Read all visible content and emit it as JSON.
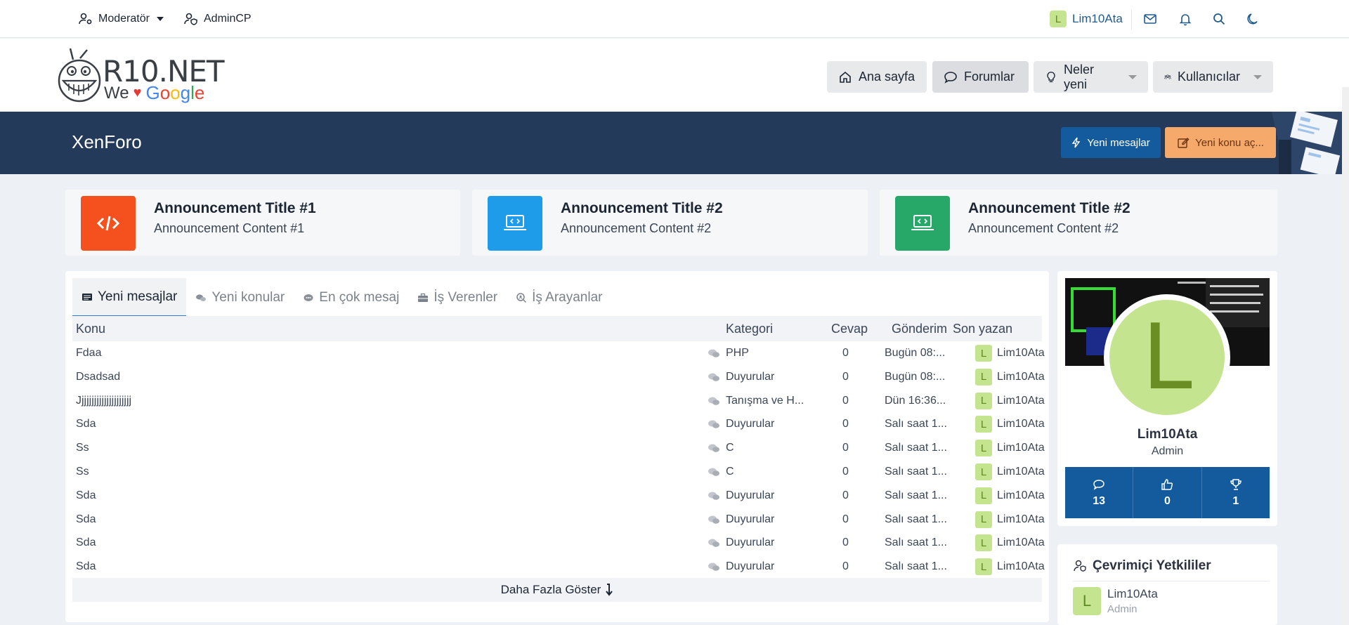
{
  "topbar": {
    "moderator_label": "Moderatör",
    "admincp_label": "AdminCP",
    "user_initial": "L",
    "username": "Lim10Ata"
  },
  "logo": {
    "name": "R10.NET",
    "tagline_we": "We",
    "tagline_google": [
      "G",
      "o",
      "o",
      "g",
      "l",
      "e"
    ]
  },
  "nav": {
    "home": "Ana sayfa",
    "forums": "Forumlar",
    "whats_new": "Neler yeni",
    "users": "Kullanıcılar"
  },
  "banner": {
    "title": "XenForo",
    "new_messages": "Yeni mesajlar",
    "new_topic": "Yeni konu aç..."
  },
  "announcements": [
    {
      "title": "Announcement Title #1",
      "content": "Announcement Content #1",
      "color": "#f4511e",
      "icon": "code-icon"
    },
    {
      "title": "Announcement Title #2",
      "content": "Announcement Content #2",
      "color": "#1e9be9",
      "icon": "laptop-code-icon"
    },
    {
      "title": "Announcement Title #2",
      "content": "Announcement Content #2",
      "color": "#27a869",
      "icon": "laptop-code-icon"
    }
  ],
  "tabs": [
    "Yeni mesajlar",
    "Yeni konular",
    "En çok mesaj",
    "İş Verenler",
    "İş Arayanlar"
  ],
  "table": {
    "headers": {
      "topic": "Konu",
      "category": "Kategori",
      "replies": "Cevap",
      "sent": "Gönderim",
      "last_poster": "Son yazan"
    },
    "rows": [
      {
        "topic": "Fdaa",
        "category": "PHP",
        "replies": "0",
        "sent": "Bugün 08:...",
        "initial": "L",
        "user": "Lim10Ata"
      },
      {
        "topic": "Dsadsad",
        "category": "Duyurular",
        "replies": "0",
        "sent": "Bugün 08:...",
        "initial": "L",
        "user": "Lim10Ata"
      },
      {
        "topic": "Jjjjjjjjjjjjjjjjjjjjj",
        "category": "Tanışma ve H...",
        "replies": "0",
        "sent": "Dün 16:36...",
        "initial": "L",
        "user": "Lim10Ata"
      },
      {
        "topic": "Sda",
        "category": "Duyurular",
        "replies": "0",
        "sent": "Salı saat 1...",
        "initial": "L",
        "user": "Lim10Ata"
      },
      {
        "topic": "Ss",
        "category": "C",
        "replies": "0",
        "sent": "Salı saat 1...",
        "initial": "L",
        "user": "Lim10Ata"
      },
      {
        "topic": "Ss",
        "category": "C",
        "replies": "0",
        "sent": "Salı saat 1...",
        "initial": "L",
        "user": "Lim10Ata"
      },
      {
        "topic": "Sda",
        "category": "Duyurular",
        "replies": "0",
        "sent": "Salı saat 1...",
        "initial": "L",
        "user": "Lim10Ata"
      },
      {
        "topic": "Sda",
        "category": "Duyurular",
        "replies": "0",
        "sent": "Salı saat 1...",
        "initial": "L",
        "user": "Lim10Ata"
      },
      {
        "topic": "Sda",
        "category": "Duyurular",
        "replies": "0",
        "sent": "Salı saat 1...",
        "initial": "L",
        "user": "Lim10Ata"
      },
      {
        "topic": "Sda",
        "category": "Duyurular",
        "replies": "0",
        "sent": "Salı saat 1...",
        "initial": "L",
        "user": "Lim10Ata"
      }
    ],
    "show_more": "Daha Fazla Göster"
  },
  "profile": {
    "initial": "L",
    "name": "Lim10Ata",
    "role": "Admin",
    "stats": {
      "messages": "13",
      "likes": "0",
      "trophies": "1"
    }
  },
  "staff": {
    "title": "Çevrimiçi Yetkililer",
    "members": [
      {
        "initial": "L",
        "name": "Lim10Ata",
        "role": "Admin"
      }
    ]
  }
}
